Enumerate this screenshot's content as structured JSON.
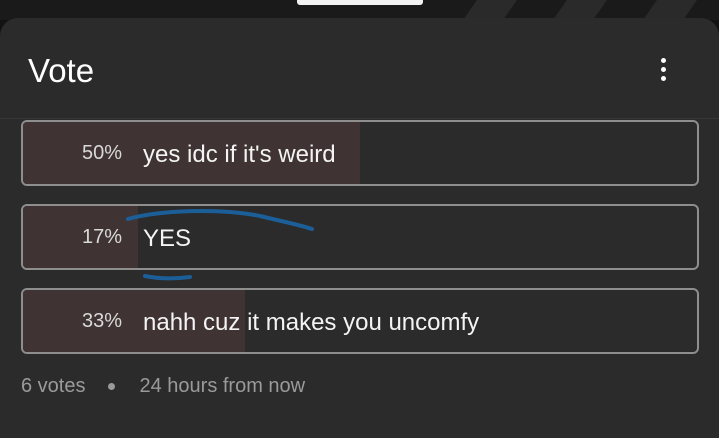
{
  "header": {
    "title": "Vote"
  },
  "poll": {
    "options": [
      {
        "percent_label": "50%",
        "fraction": 0.5,
        "label": "yes idc if it's weird"
      },
      {
        "percent_label": "17%",
        "fraction": 0.17,
        "label": "YES"
      },
      {
        "percent_label": "33%",
        "fraction": 0.33,
        "label": "nahh cuz it makes you uncomfy"
      }
    ],
    "votes": "6 votes",
    "time_left": "24 hours from now"
  },
  "colors": {
    "card_background": "#2a2b2a",
    "result_fill": "#3f3333",
    "option_border": "#8d8e8d",
    "ink_annotation": "#1c5e98"
  },
  "icons": {
    "menu": "more-vertical-icon"
  }
}
